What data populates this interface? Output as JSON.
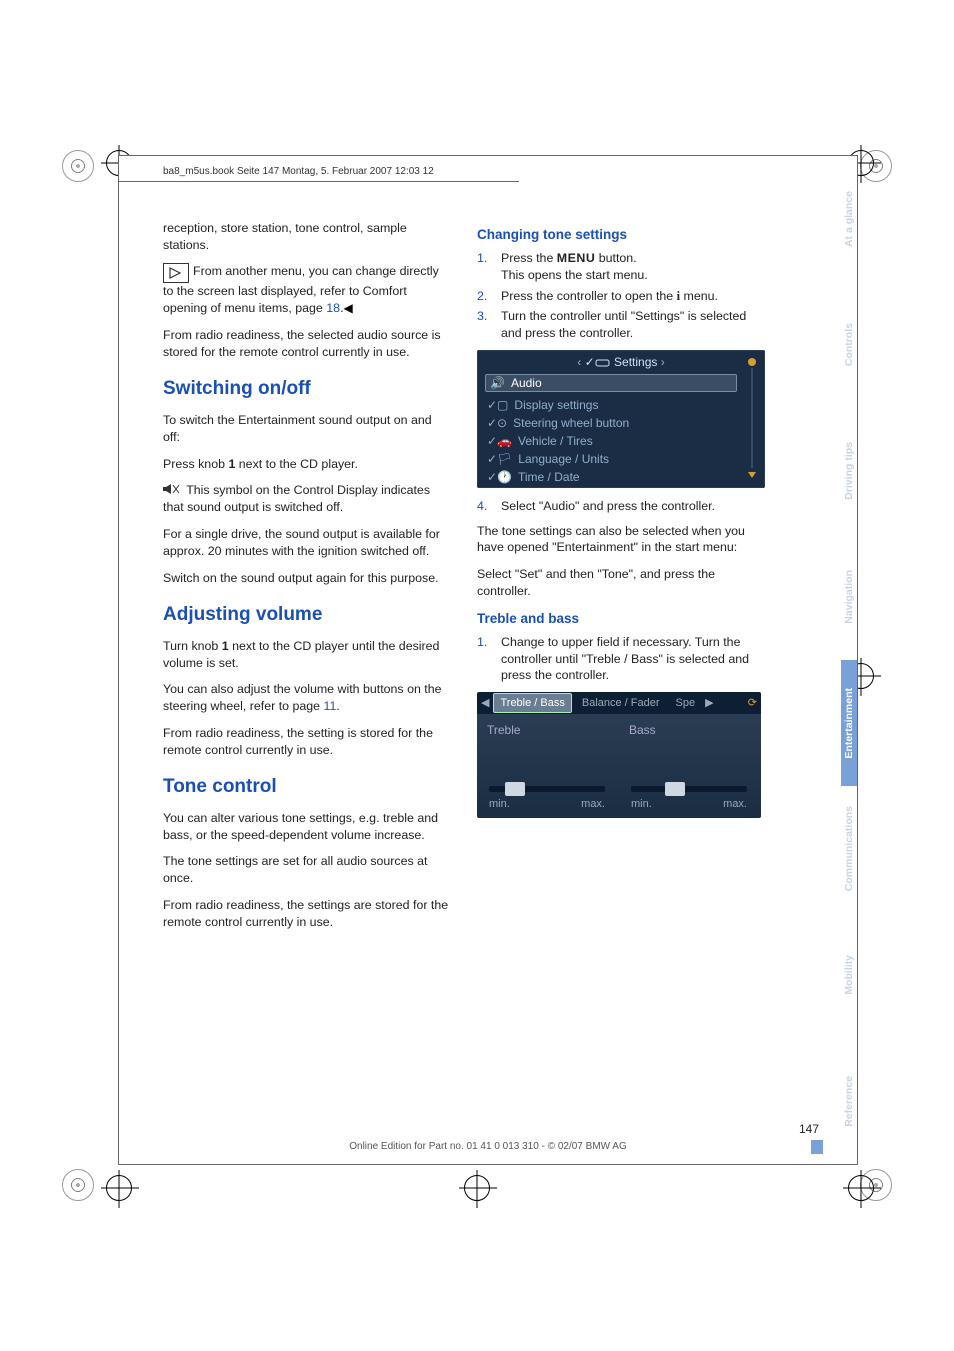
{
  "header": {
    "crop_line": "ba8_m5us.book  Seite 147  Montag, 5. Februar 2007  12:03 12"
  },
  "col1": {
    "p1": "reception, store station, tone control, sample stations.",
    "note": "From another menu, you can change directly to the screen last displayed, refer to Comfort opening of menu items, page ",
    "note_page": "18",
    "note_end": ".",
    "p2": "From radio readiness, the selected audio source is stored for the remote control currently in use.",
    "h_switch": "Switching on/off",
    "p3": "To switch the Entertainment sound output on and off:",
    "p4a": "Press knob ",
    "p4bold": "1",
    "p4b": " next to the CD player.",
    "p5": " This symbol on the Control Display indicates that sound output is switched off.",
    "p6": "For a single drive, the sound output is available for approx. 20 minutes with the ignition switched off.",
    "p7": "Switch on the sound output again for this purpose.",
    "h_vol": "Adjusting volume",
    "p8a": "Turn knob ",
    "p8bold": "1",
    "p8b": " next to the CD player until the desired volume is set.",
    "p9a": "You can also adjust the volume with buttons on the steering wheel, refer to page ",
    "p9link": "11",
    "p9b": ".",
    "p10": "From radio readiness, the setting is stored for the remote control currently in use.",
    "h_tone": "Tone control",
    "p11": "You can alter various tone settings, e.g. treble and bass, or the speed-dependent volume increase.",
    "p12": "The tone settings are set for all audio sources at once.",
    "p13": "From radio readiness, the settings are stored for the remote control currently in use."
  },
  "col2": {
    "h_change": "Changing tone settings",
    "s1_a": "Press the ",
    "s1_menu": "MENU",
    "s1_b": " button.",
    "s1_c": "This opens the start menu.",
    "s2_a": "Press the controller to open the ",
    "s2_b": " menu.",
    "s3": "Turn the controller until \"Settings\" is selected and press the controller.",
    "ss1": {
      "title": "Settings",
      "items": [
        "Audio",
        "Display settings",
        "Steering wheel button",
        "Vehicle / Tires",
        "Language / Units",
        "Time / Date"
      ]
    },
    "s4": "Select \"Audio\" and press the controller.",
    "p_after": "The tone settings can also be selected when you have opened \"Entertainment\" in the start menu:",
    "p_after2": "Select \"Set\" and then \"Tone\", and press the controller.",
    "h_treble": "Treble and bass",
    "tb1": "Change to upper field if necessary. Turn the controller until \"Treble / Bass\" is selected and press the controller.",
    "ss2": {
      "tab_active": "Treble / Bass",
      "tab2": "Balance / Fader",
      "tab3": "Spe",
      "left_label": "Treble",
      "right_label": "Bass",
      "min": "min.",
      "max": "max."
    }
  },
  "sidebar": {
    "tabs": [
      "Reference",
      "Mobility",
      "Communications",
      "Entertainment",
      "Navigation",
      "Driving tips",
      "Controls",
      "At a glance"
    ]
  },
  "footer": {
    "pagenum": "147",
    "line": "Online Edition for Part no. 01 41 0 013 310 - © 02/07 BMW AG"
  }
}
